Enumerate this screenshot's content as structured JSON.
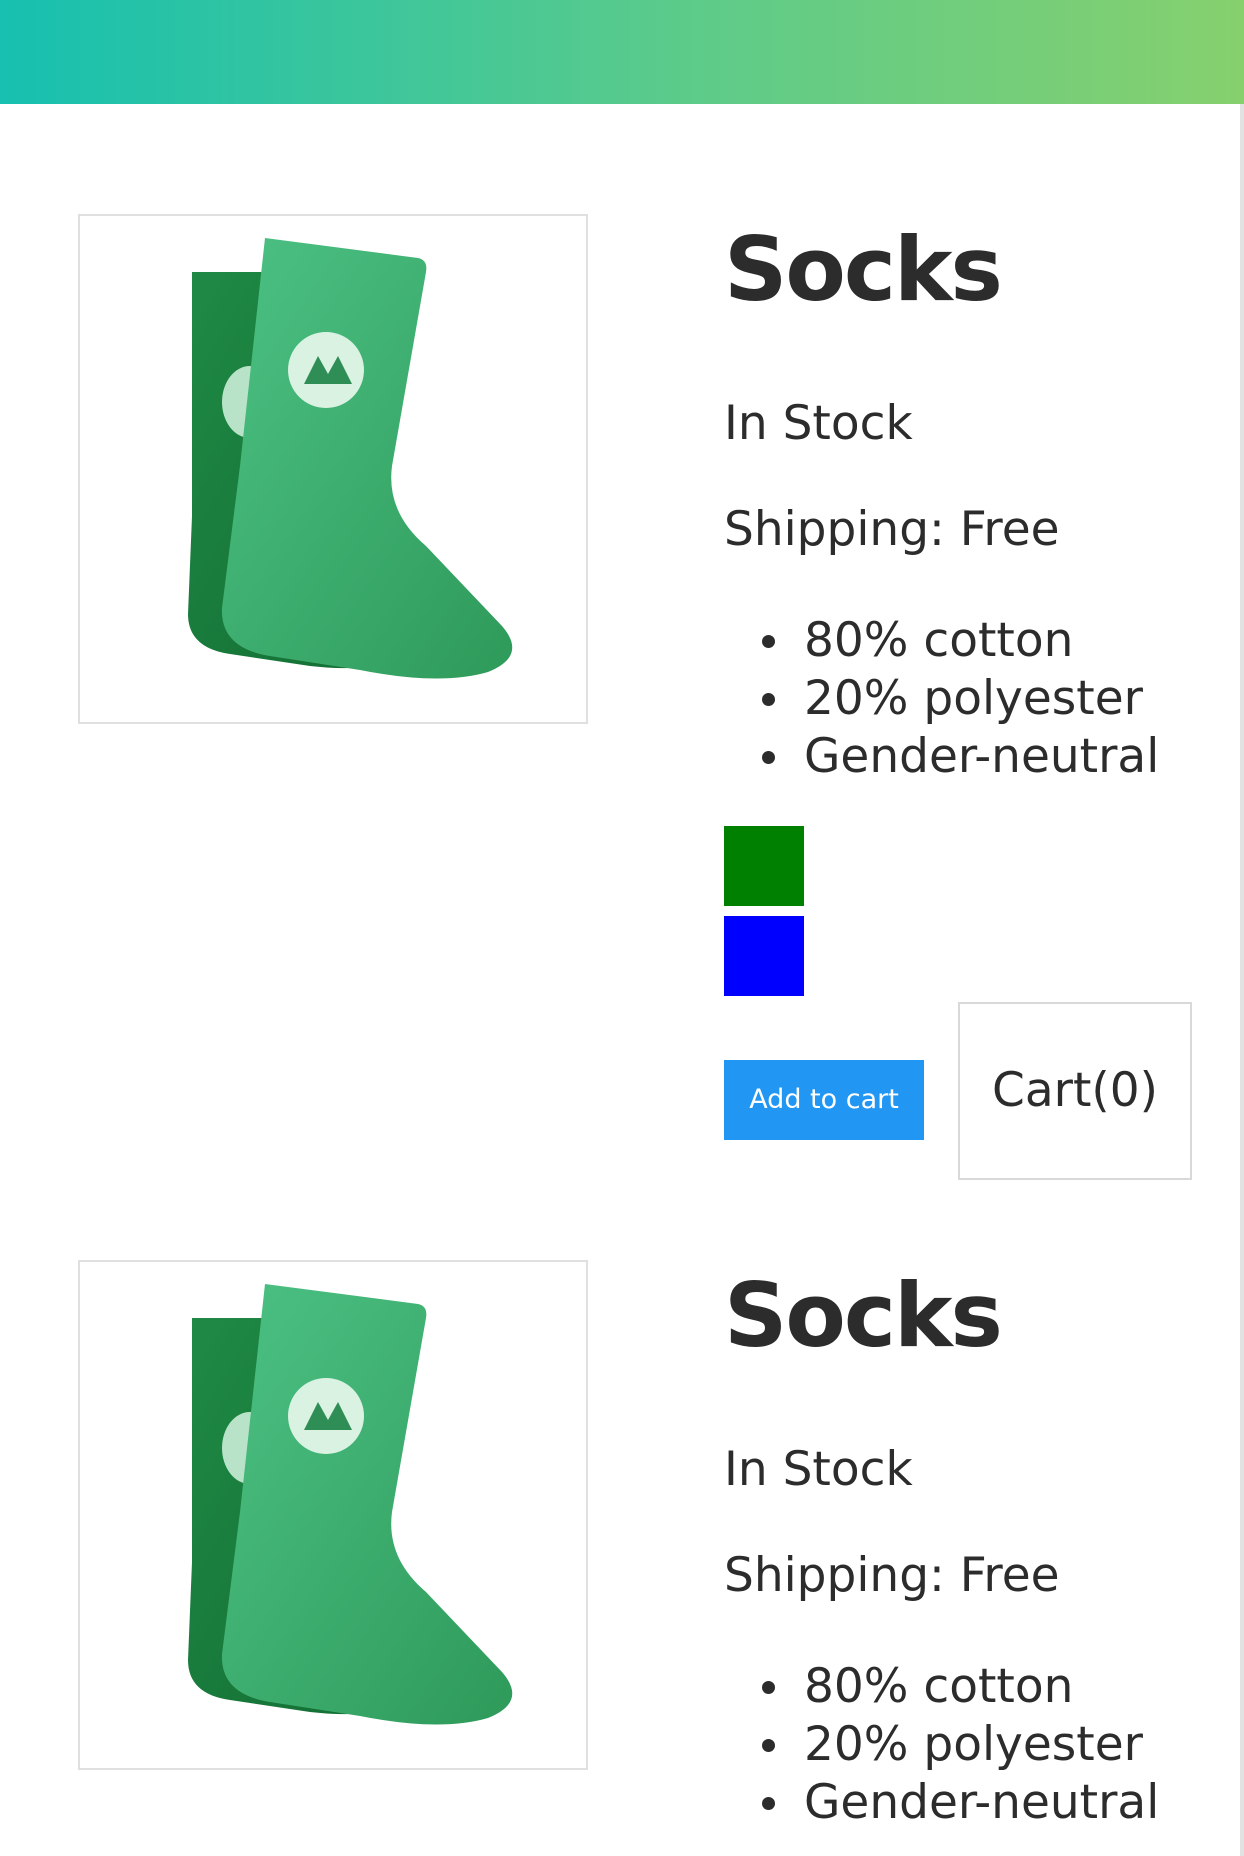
{
  "header": {
    "gradient_start": "#17c0b0",
    "gradient_end": "#86d06e"
  },
  "products": [
    {
      "image_icon": "green-socks-image",
      "title": "Socks",
      "stock": "In Stock",
      "shipping": "Shipping: Free",
      "details": [
        "80% cotton",
        "20% polyester",
        "Gender-neutral"
      ],
      "variants": [
        {
          "color": "#008000"
        },
        {
          "color": "#0000ff"
        }
      ],
      "add_to_cart_label": "Add to cart",
      "cart_label": "Cart(0)"
    },
    {
      "image_icon": "green-socks-image",
      "title": "Socks",
      "stock": "In Stock",
      "shipping": "Shipping: Free",
      "details": [
        "80% cotton",
        "20% polyester",
        "Gender-neutral"
      ]
    }
  ],
  "colors": {
    "button_blue": "#2196f3",
    "sock_green": "#3daa6a",
    "sock_dark_green": "#1f7a3c"
  }
}
